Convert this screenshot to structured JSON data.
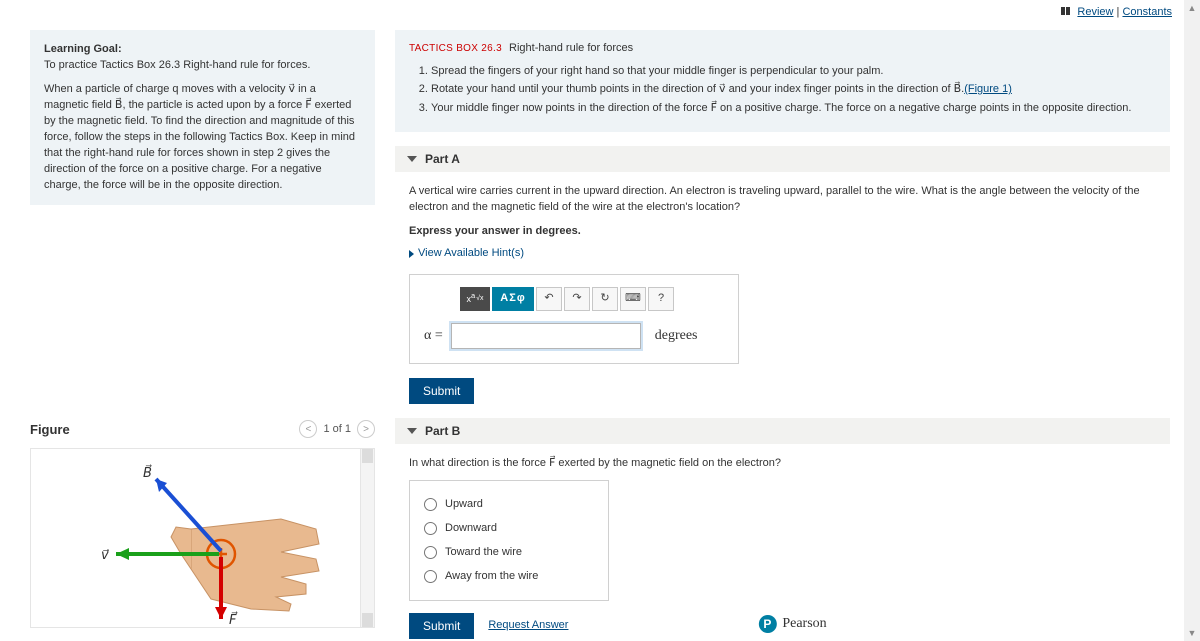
{
  "topbar": {
    "review": "Review",
    "sep": " | ",
    "constants": "Constants"
  },
  "goal": {
    "title": "Learning Goal:",
    "subtitle": "To practice Tactics Box 26.3 Right-hand rule for forces.",
    "para": "When a particle of charge q moves with a velocity v⃗ in a magnetic field B⃗, the particle is acted upon by a force F⃗ exerted by the magnetic field. To find the direction and magnitude of this force, follow the steps in the following Tactics Box. Keep in mind that the right-hand rule for forces shown in step 2 gives the direction of the force on a positive charge. For a negative charge, the force will be in the opposite direction."
  },
  "figure": {
    "title": "Figure",
    "counter": "1 of 1",
    "labels": {
      "B": "B⃗",
      "v": "v⃗",
      "F": "F⃗"
    }
  },
  "tactics": {
    "title": "TACTICS BOX 26.3",
    "subtitle": "Right-hand rule for forces",
    "steps": [
      "Spread the fingers of your right hand so that your middle finger is perpendicular to your palm.",
      "Rotate your hand until your thumb points in the direction of v⃗ and your index finger points in the direction of B⃗.",
      "Your middle finger now points in the direction of the force F⃗ on a positive charge. The force on a negative charge points in the opposite direction."
    ],
    "fig_link": "(Figure 1)"
  },
  "partA": {
    "header": "Part A",
    "question": "A vertical wire carries current in the upward direction. An electron is traveling upward, parallel to the wire. What is the angle between the velocity of the electron and the magnetic field of the wire at the electron's location?",
    "instruction": "Express your answer in degrees.",
    "hint": "View Available Hint(s)",
    "alpha": "α =",
    "unit": "degrees",
    "submit": "Submit",
    "tools": {
      "template": "√x",
      "symbols": "ΑΣφ",
      "undo": "↶",
      "redo": "↷",
      "reset": "↻",
      "keyboard": "⌨",
      "help": "?"
    }
  },
  "partB": {
    "header": "Part B",
    "question": "In what direction is the force F⃗ exerted by the magnetic field on the electron?",
    "choices": [
      "Upward",
      "Downward",
      "Toward the wire",
      "Away from the wire"
    ],
    "submit": "Submit",
    "request": "Request Answer"
  },
  "footer": {
    "brand": "Pearson"
  }
}
